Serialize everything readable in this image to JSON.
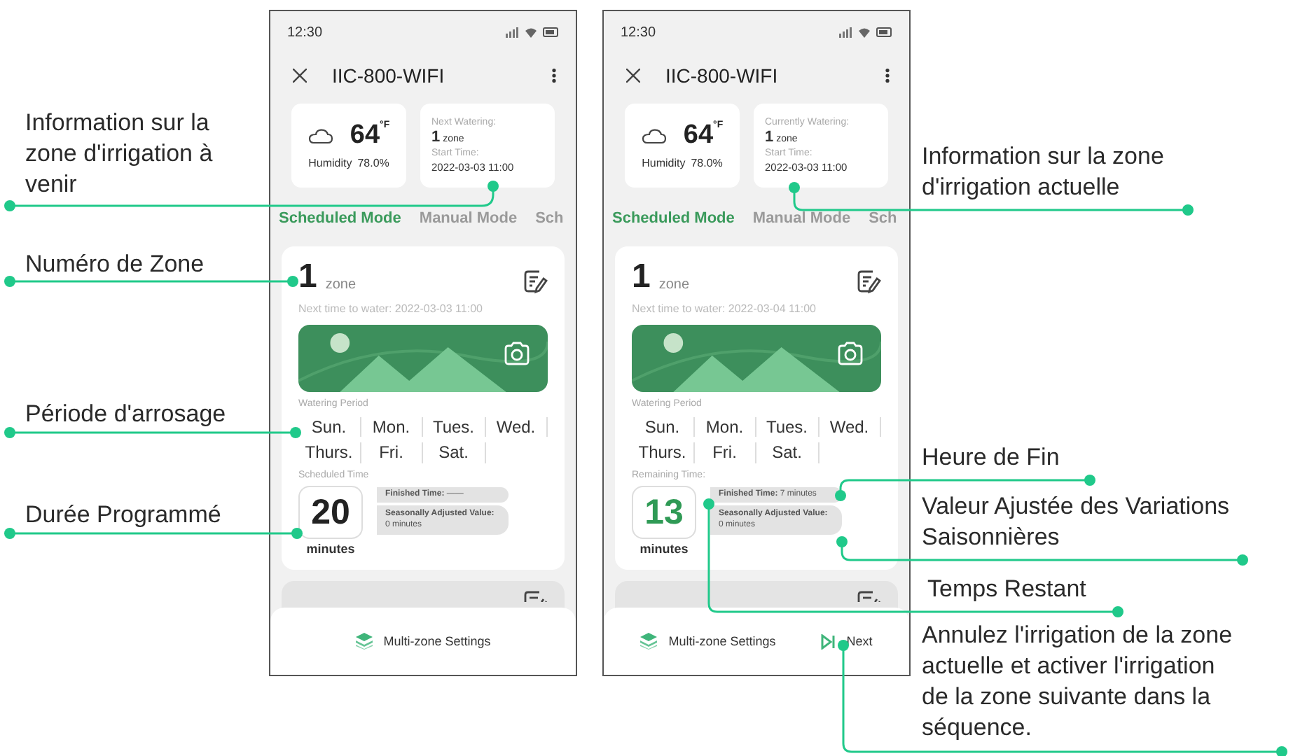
{
  "phones": [
    {
      "status_time": "12:30",
      "title": "IIC-800-WIFI",
      "weather": {
        "temperature": "64",
        "unit": "°F",
        "humidity_label": "Humidity",
        "humidity": "78.0%"
      },
      "info": {
        "label": "Next Watering:",
        "zone_number": "1",
        "zone_unit": "zone",
        "start_label": "Start Time:",
        "start_time": "2022-03-03 11:00"
      },
      "tabs": [
        {
          "label": "Scheduled Mode",
          "selected": true
        },
        {
          "label": "Manual Mode",
          "selected": false
        },
        {
          "label": "Sch",
          "selected": false
        }
      ],
      "zone": {
        "number": "1",
        "unit": "zone",
        "next_time": "Next time to water: 2022-03-03 11:00",
        "period_label": "Watering Period",
        "days": [
          "Sun.",
          "Mon.",
          "Tues.",
          "Wed.",
          "Thurs.",
          "Fri.",
          "Sat."
        ],
        "watering": false,
        "time_label": "Scheduled Time",
        "minutes": "20",
        "minutes_unit": "minutes",
        "finished": "**Finished Time:** ——",
        "seasonal": "**Seasonally Adjusted Value:** 0 minutes"
      },
      "buttons": [
        {
          "kind": "layers",
          "label": "Multi-zone Settings"
        }
      ]
    },
    {
      "status_time": "12:30",
      "title": "IIC-800-WIFI",
      "weather": {
        "temperature": "64",
        "unit": "°F",
        "humidity_label": "Humidity",
        "humidity": "78.0%"
      },
      "info": {
        "label": "Currently Watering:",
        "zone_number": "1",
        "zone_unit": "zone",
        "start_label": "Start Time:",
        "start_time": "2022-03-03 11:00"
      },
      "tabs": [
        {
          "label": "Scheduled Mode",
          "selected": true
        },
        {
          "label": "Manual Mode",
          "selected": false
        },
        {
          "label": "Sch",
          "selected": false
        }
      ],
      "zone": {
        "number": "1",
        "unit": "zone",
        "next_time": "Next time to water: 2022-03-04 11:00",
        "period_label": "Watering Period",
        "days": [
          "Sun.",
          "Mon.",
          "Tues.",
          "Wed.",
          "Thurs.",
          "Fri.",
          "Sat."
        ],
        "watering": true,
        "time_label": "Remaining Time:",
        "minutes": "13",
        "minutes_unit": "minutes",
        "finished": "**Finished Time:** 7 minutes",
        "seasonal": "**Seasonally Adjusted Value:** 0 minutes"
      },
      "buttons": [
        {
          "kind": "layers",
          "label": "Multi-zone Settings"
        },
        {
          "kind": "skip",
          "label": "Next"
        }
      ]
    }
  ],
  "annotations": [
    {
      "text": "Information sur la zone d'irrigation à venir"
    },
    {
      "text": "Numéro de Zone"
    },
    {
      "text": "Période d'arrosage"
    },
    {
      "text": "Durée Programmé"
    },
    {
      "text": "Information sur la zone d'irrigation actuelle"
    },
    {
      "text": "Heure de Fin"
    },
    {
      "text": "Valeur Ajustée des Variations Saisonnières"
    },
    {
      "text": "Temps Restant"
    },
    {
      "text": "Annulez l'irrigation de la zone actuelle et activer l'irrigation de la zone suivante dans la séquence."
    }
  ]
}
